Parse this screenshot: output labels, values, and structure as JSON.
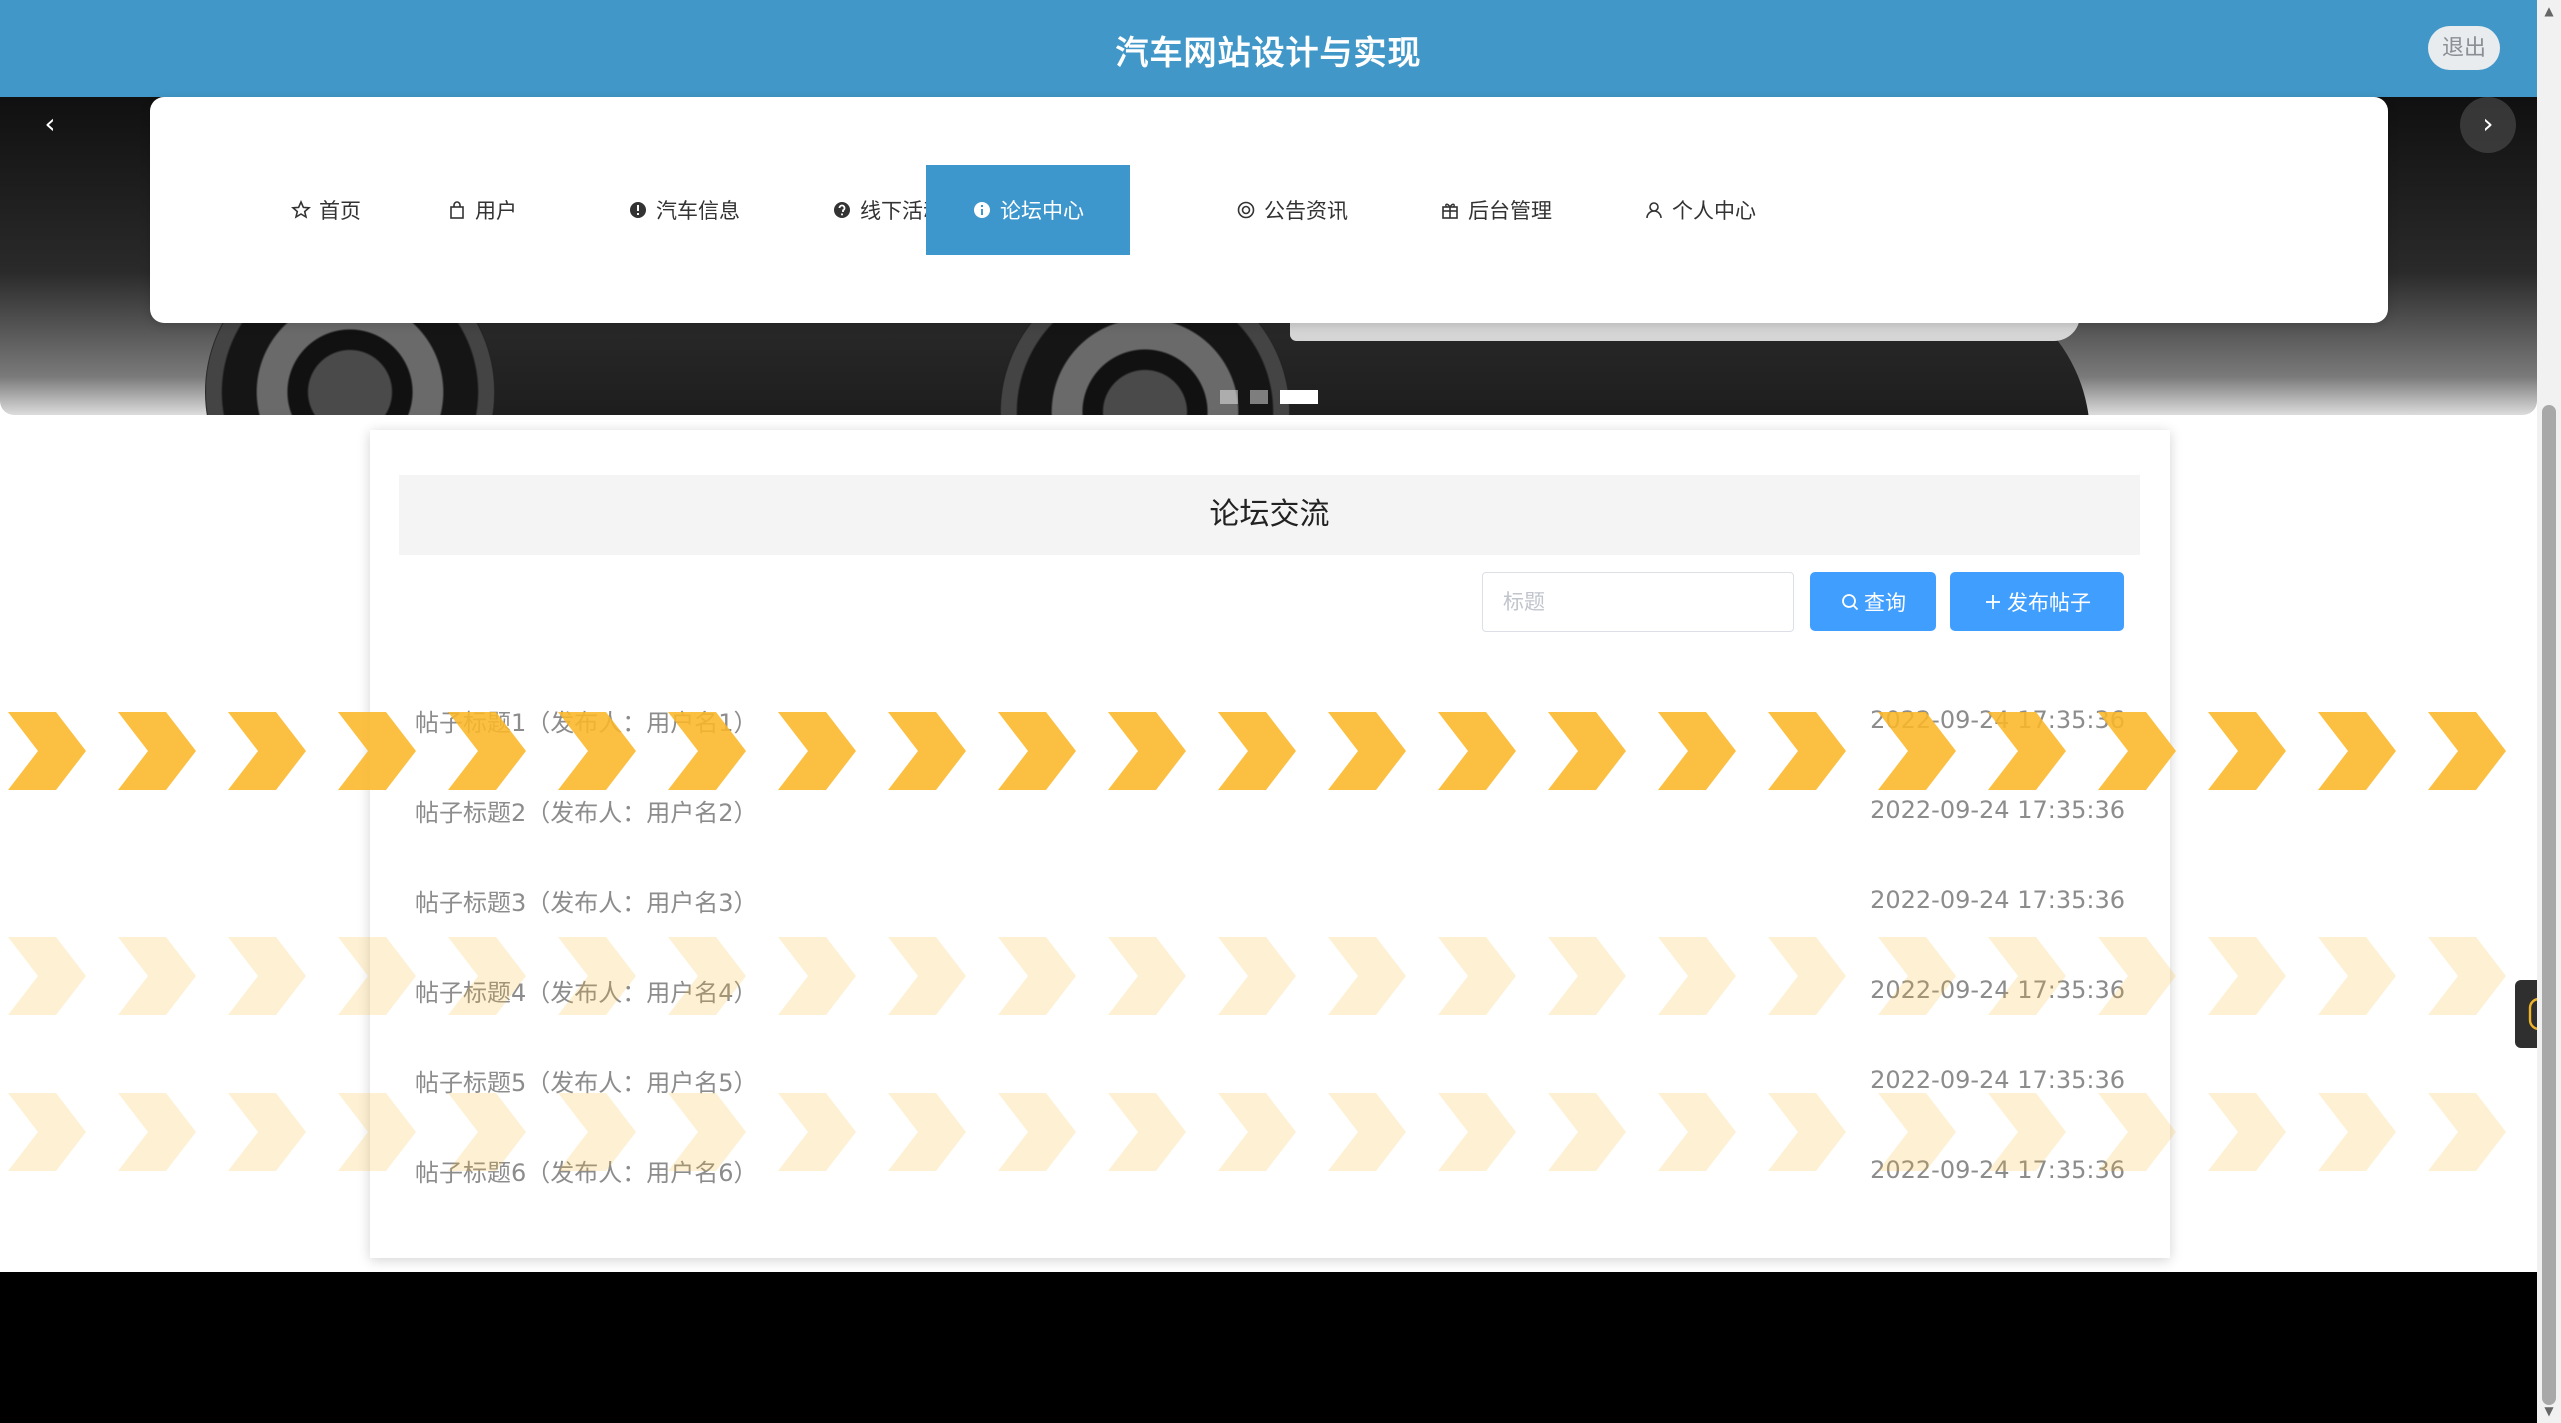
{
  "header": {
    "title": "汽车网站设计与实现",
    "logout_label": "退出"
  },
  "banner": {
    "prev_label": "‹",
    "next_label": "›",
    "slide_count": 3,
    "active_slide": 3
  },
  "nav": {
    "items": [
      {
        "label": "首页",
        "icon": "star-icon"
      },
      {
        "label": "用户",
        "icon": "bag-icon"
      },
      {
        "label": "汽车信息",
        "icon": "info-circle-icon"
      },
      {
        "label": "线下活动",
        "icon": "question-circle-icon"
      },
      {
        "label": "论坛中心",
        "icon": "info-circle-icon",
        "active": true
      },
      {
        "label": "公告资讯",
        "icon": "target-icon"
      },
      {
        "label": "后台管理",
        "icon": "gift-icon"
      },
      {
        "label": "个人中心",
        "icon": "user-icon"
      }
    ]
  },
  "forum": {
    "title": "论坛交流",
    "search_placeholder": "标题",
    "search_value": "",
    "query_label": "查询",
    "publish_label": "发布帖子",
    "posts": [
      {
        "title": "帖子标题1（发布人：用户名1）",
        "time": "2022-09-24 17:35:36"
      },
      {
        "title": "帖子标题2（发布人：用户名2）",
        "time": "2022-09-24 17:35:36"
      },
      {
        "title": "帖子标题3（发布人：用户名3）",
        "time": "2022-09-24 17:35:36"
      },
      {
        "title": "帖子标题4（发布人：用户名4）",
        "time": "2022-09-24 17:35:36"
      },
      {
        "title": "帖子标题5（发布人：用户名5）",
        "time": "2022-09-24 17:35:36"
      },
      {
        "title": "帖子标题6（发布人：用户名6）",
        "time": "2022-09-24 17:35:36"
      }
    ]
  },
  "colors": {
    "header_bg": "#4097c8",
    "nav_active_bg": "#3d97cc",
    "button_primary": "#409eff",
    "chevron": "#fbb829"
  }
}
